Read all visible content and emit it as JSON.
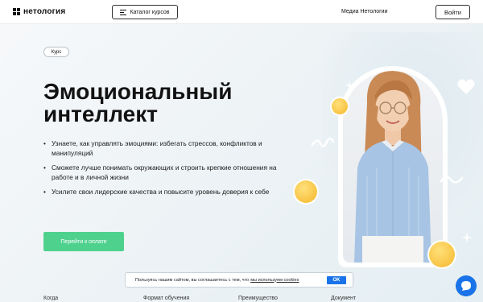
{
  "header": {
    "logo_text": "нетология",
    "catalog_label": "Каталог курсов",
    "media_label": "Медиа Нетологии",
    "login_label": "Войти"
  },
  "hero": {
    "badge": "Курс",
    "title_line1": "Эмоциональный",
    "title_line2": "интеллект",
    "bullets": [
      "Узнаете, как управлять эмоциями: избегать стрессов, конфликтов и манипуляций",
      "Сможете лучше понимать окружающих и строить крепкие отношения на работе и в личной жизни",
      "Усилите свои лидерские качества и повысите уровень доверия к себе"
    ],
    "cta_label": "Перейти к оплате"
  },
  "cookie": {
    "text": "Пользуясь нашим сайтом, вы соглашаетесь с тем, что",
    "link": "мы используем cookies",
    "ok": "OK"
  },
  "bottom_nav": [
    "Когда",
    "Формат обучения",
    "Преимущество",
    "Документ"
  ],
  "colors": {
    "accent_green": "#4fd18e",
    "accent_blue": "#1a73e8",
    "shirt_blue": "#a8c4e4"
  },
  "icons": [
    "menu-list-icon",
    "chat-icon",
    "sparkle-icon",
    "heart-icon",
    "emoji-laughing-icon",
    "emoji-grinning-icon",
    "emoji-heart-eyes-icon"
  ]
}
